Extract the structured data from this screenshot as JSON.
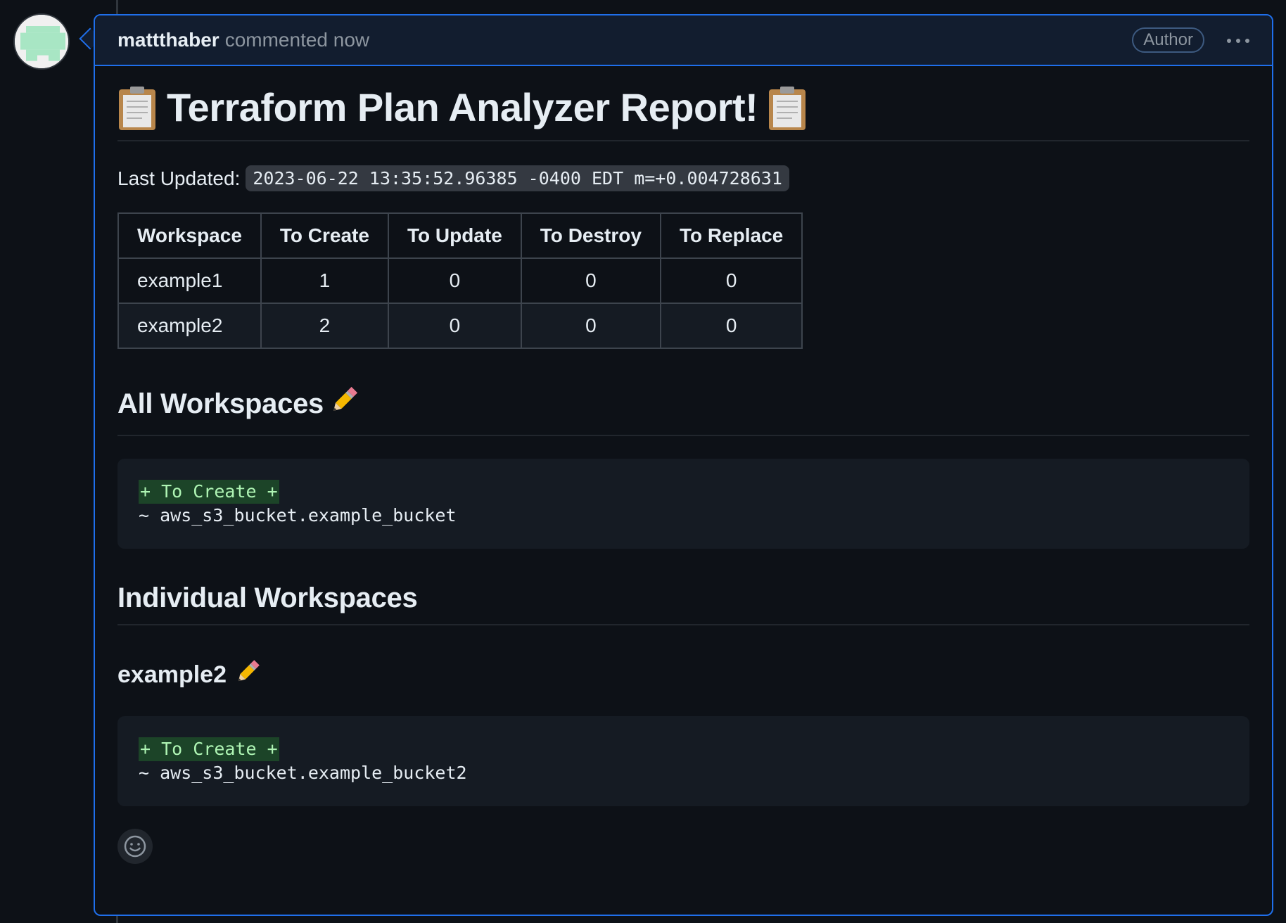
{
  "comment": {
    "author": "mattthaber",
    "action": "commented now",
    "badge": "Author"
  },
  "report": {
    "title": "Terraform Plan Analyzer Report!",
    "last_updated_label": "Last Updated:",
    "last_updated_value": "2023-06-22 13:35:52.96385 -0400 EDT m=+0.004728631",
    "table": {
      "headers": [
        "Workspace",
        "To Create",
        "To Update",
        "To Destroy",
        "To Replace"
      ],
      "rows": [
        [
          "example1",
          "1",
          "0",
          "0",
          "0"
        ],
        [
          "example2",
          "2",
          "0",
          "0",
          "0"
        ]
      ]
    },
    "all_workspaces": {
      "heading": "All Workspaces",
      "code_add": "+ To Create +",
      "code_line": "~ aws_s3_bucket.example_bucket"
    },
    "individual": {
      "heading": "Individual Workspaces",
      "workspace_name": "example2",
      "code_add": "+ To Create +",
      "code_line": "~ aws_s3_bucket.example_bucket2"
    }
  },
  "icons": {
    "more": "kebab-horizontal-icon",
    "reaction": "smiley-icon",
    "clipboard": "clipboard-emoji",
    "pencil": "pencil-emoji"
  },
  "colors": {
    "accent_border": "#1f6feb",
    "header_bg": "#121d2f",
    "diff_add_bg": "#1c4428",
    "diff_add_fg": "#aff5b4"
  }
}
